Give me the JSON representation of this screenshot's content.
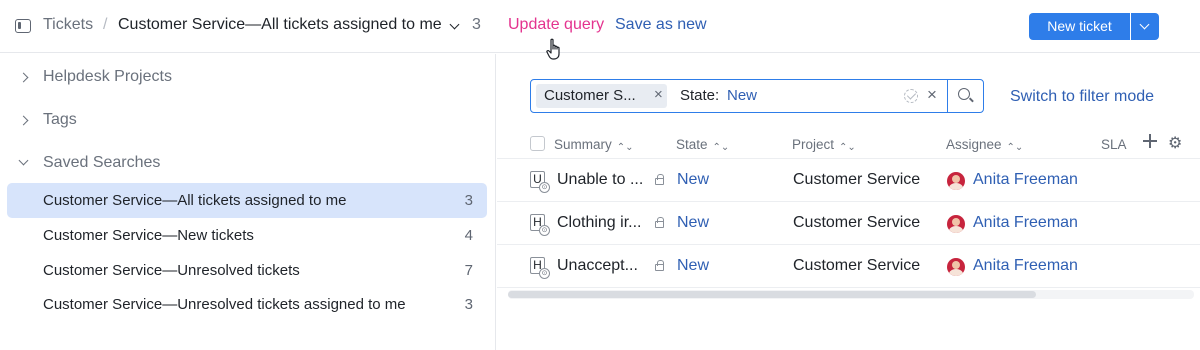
{
  "header": {
    "breadcrumb_root": "Tickets",
    "breadcrumb_separator": "/",
    "current_search": "Customer Service—All tickets assigned to me",
    "current_count": "3",
    "update_query_label": "Update query",
    "save_as_new_label": "Save as new",
    "new_ticket_label": "New ticket"
  },
  "sidebar": {
    "sections": [
      {
        "label": "Helpdesk Projects",
        "expanded": false
      },
      {
        "label": "Tags",
        "expanded": false
      },
      {
        "label": "Saved Searches",
        "expanded": true
      }
    ],
    "saved_searches": [
      {
        "name": "Customer Service—All tickets assigned to me",
        "count": "3",
        "active": true
      },
      {
        "name": "Customer Service—New tickets",
        "count": "4",
        "active": false
      },
      {
        "name": "Customer Service—Unresolved tickets",
        "count": "7",
        "active": false
      },
      {
        "name": "Customer Service—Unresolved tickets assigned to me",
        "count": "3",
        "active": false
      }
    ]
  },
  "search": {
    "chip_label": "Customer S...",
    "chip_remove": "×",
    "state_label": "State:",
    "state_value": "New",
    "clear": "×",
    "switch_mode_label": "Switch to filter mode"
  },
  "table": {
    "columns": [
      "Summary",
      "State",
      "Project",
      "Assignee",
      "SLA"
    ],
    "sort_glyph": "⌃⌄",
    "gear_glyph": "⚙",
    "rows": [
      {
        "icon_letter": "U",
        "summary": "Unable to ...",
        "state": "New",
        "project": "Customer Service",
        "assignee": "Anita Freeman"
      },
      {
        "icon_letter": "H",
        "summary": "Clothing ir...",
        "state": "New",
        "project": "Customer Service",
        "assignee": "Anita Freeman"
      },
      {
        "icon_letter": "H",
        "summary": "Unaccept...",
        "state": "New",
        "project": "Customer Service",
        "assignee": "Anita Freeman"
      }
    ]
  },
  "colors": {
    "accent": "#2e7de9",
    "link": "#2f5fb3",
    "update_query": "#e4338f",
    "active_row": "#d7e4fb"
  }
}
